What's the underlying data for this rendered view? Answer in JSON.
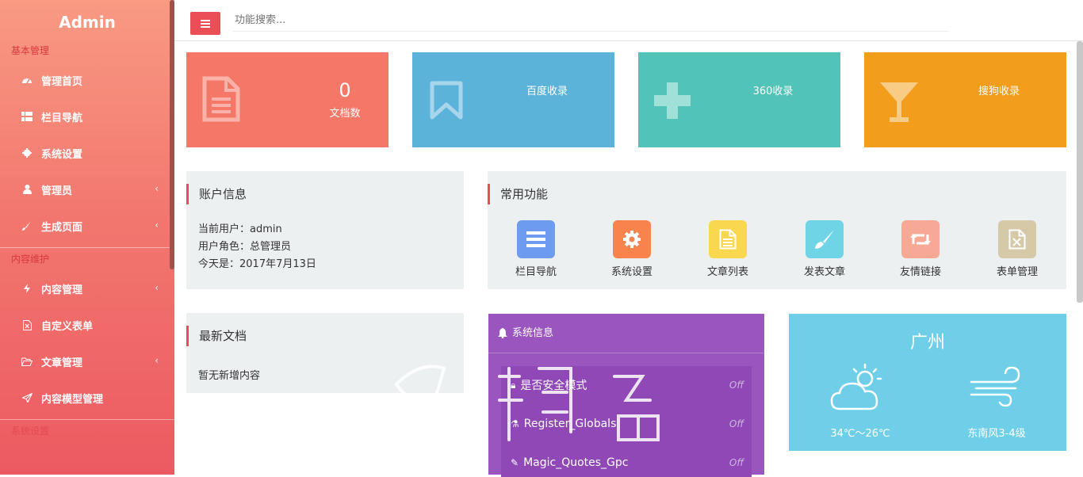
{
  "sidebar": {
    "brand": "Admin",
    "sections": [
      {
        "title": "基本管理"
      },
      {
        "title": "内容维护"
      },
      {
        "title": "系统设置"
      }
    ],
    "items": [
      {
        "label": "管理首页",
        "icon": "dashboard-icon",
        "has_submenu": false
      },
      {
        "label": "栏目导航",
        "icon": "list-icon",
        "has_submenu": false
      },
      {
        "label": "系统设置",
        "icon": "gear-icon",
        "has_submenu": false
      },
      {
        "label": "管理员",
        "icon": "user-icon",
        "has_submenu": true
      },
      {
        "label": "生成页面",
        "icon": "brush-icon",
        "has_submenu": true
      },
      {
        "label": "内容管理",
        "icon": "bolt-icon",
        "has_submenu": true
      },
      {
        "label": "自定义表单",
        "icon": "excel-file-icon",
        "has_submenu": false
      },
      {
        "label": "文章管理",
        "icon": "folder-open-icon",
        "has_submenu": true
      },
      {
        "label": "内容模型管理",
        "icon": "paper-plane-icon",
        "has_submenu": false
      }
    ],
    "chevron": "‹"
  },
  "topbar": {
    "search_placeholder": "功能搜索..."
  },
  "stats": [
    {
      "value": "0",
      "label": "文档数",
      "color": "#f47768",
      "icon": "document-icon"
    },
    {
      "label": "百度收录",
      "color": "#5bb3da",
      "icon": "bookmark-icon"
    },
    {
      "label": "360收录",
      "color": "#52c3b8",
      "icon": "plus-icon"
    },
    {
      "label": "搜狗收录",
      "color": "#f39d1c",
      "icon": "glass-icon"
    }
  ],
  "account": {
    "title": "账户信息",
    "lines": [
      "当前用户：admin",
      "用户角色：总管理员",
      "今天是：2017年7月13日"
    ]
  },
  "common": {
    "title": "常用功能",
    "items": [
      {
        "label": "栏目导航",
        "color": "#6d9cef",
        "icon": "list-icon"
      },
      {
        "label": "系统设置",
        "color": "#f9834d",
        "icon": "gear-icon"
      },
      {
        "label": "文章列表",
        "color": "#f9d84f",
        "icon": "document-icon"
      },
      {
        "label": "发表文章",
        "color": "#6ed4e6",
        "icon": "brush-icon"
      },
      {
        "label": "友情链接",
        "color": "#f8a996",
        "icon": "retweet-icon"
      },
      {
        "label": "表单管理",
        "color": "#d6c9a8",
        "icon": "excel-file-icon"
      }
    ]
  },
  "latest": {
    "title": "最新文档",
    "empty": "暂无新增内容"
  },
  "system": {
    "title": "系统信息",
    "rows": [
      {
        "label": "是否安全模式",
        "status": "Off",
        "icon": "lock-icon"
      },
      {
        "label": "Register_Globals",
        "status": "Off",
        "icon": "flask-icon"
      },
      {
        "label": "Magic_Quotes_Gpc",
        "status": "Off",
        "icon": "wand-icon"
      }
    ]
  },
  "weather": {
    "city": "广州",
    "temp": "34℃～26℃",
    "wind": "东南风3-4级"
  }
}
